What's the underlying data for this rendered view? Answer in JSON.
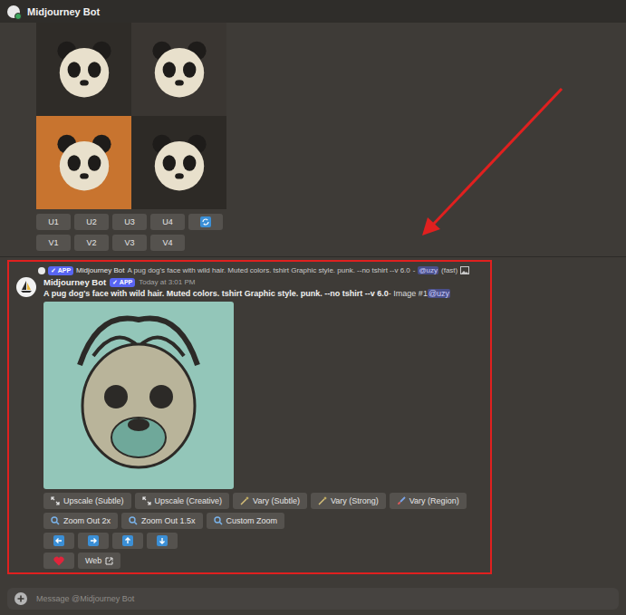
{
  "header": {
    "title": "Midjourney Bot"
  },
  "previous": {
    "images": [
      {
        "tone": "#2f2c28"
      },
      {
        "tone": "#3a3632"
      },
      {
        "tone": "#c8742f"
      },
      {
        "tone": "#2d2a26"
      }
    ],
    "upscale_buttons": [
      "U1",
      "U2",
      "U3",
      "U4"
    ],
    "variation_buttons": [
      "V1",
      "V2",
      "V3",
      "V4"
    ]
  },
  "message": {
    "reply": {
      "badge": "APP",
      "author": "Midjourney Bot",
      "prompt": "A pug dog's face with wild hair. Muted colors. tshirt Graphic style. punk. --no tshirt --v 6.0",
      "separator": "-",
      "mention": "@uzy",
      "speed": "(fast)"
    },
    "author": "Midjourney Bot",
    "badge": "APP",
    "time": "Today at 3:01 PM",
    "prompt": "A pug dog's face with wild hair. Muted colors. tshirt Graphic style. punk. --no tshirt --v 6.0",
    "image_label": "- Image #1",
    "mention": "@uzy",
    "action_rows": [
      [
        {
          "kind": "upscale",
          "label": "Upscale (Subtle)"
        },
        {
          "kind": "upscale",
          "label": "Upscale (Creative)"
        },
        {
          "kind": "vary",
          "label": "Vary (Subtle)"
        },
        {
          "kind": "vary",
          "label": "Vary (Strong)"
        },
        {
          "kind": "region",
          "label": "Vary (Region)"
        }
      ],
      [
        {
          "kind": "zoom",
          "label": "Zoom Out 2x"
        },
        {
          "kind": "zoom",
          "label": "Zoom Out 1.5x"
        },
        {
          "kind": "zoom",
          "label": "Custom Zoom"
        }
      ],
      [
        {
          "kind": "pan-left"
        },
        {
          "kind": "pan-right"
        },
        {
          "kind": "pan-up"
        },
        {
          "kind": "pan-down"
        }
      ],
      [
        {
          "kind": "heart"
        },
        {
          "kind": "link",
          "label": "Web"
        }
      ]
    ]
  },
  "composer": {
    "placeholder": "Message @Midjourney Bot"
  }
}
